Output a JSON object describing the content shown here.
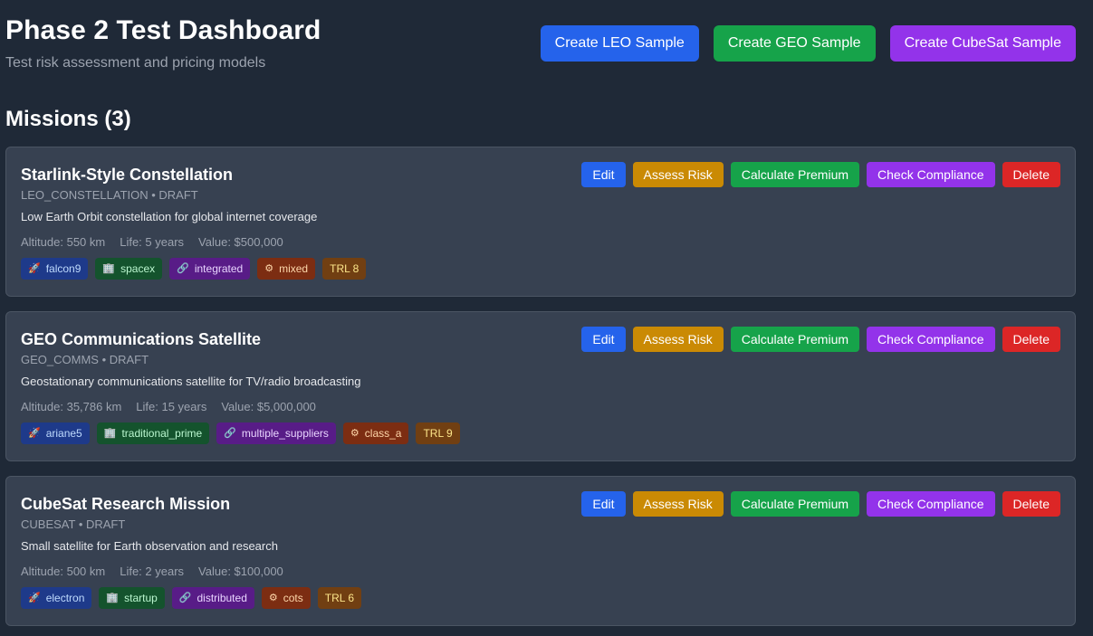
{
  "header": {
    "title": "Phase 2 Test Dashboard",
    "subtitle": "Test risk assessment and pricing models"
  },
  "sample_buttons": [
    {
      "label": "Create LEO Sample",
      "color": "#2563eb"
    },
    {
      "label": "Create GEO Sample",
      "color": "#16a34a"
    },
    {
      "label": "Create CubeSat Sample",
      "color": "#9333ea"
    }
  ],
  "missions_heading": "Missions (3)",
  "card_actions": {
    "edit": "Edit",
    "assess_risk": "Assess Risk",
    "calculate_premium": "Calculate Premium",
    "check_compliance": "Check Compliance",
    "delete": "Delete"
  },
  "colors": {
    "background": "#1f2937",
    "card": "#374151",
    "edit": "#2563eb",
    "assess_risk": "#ca8a04",
    "calculate_premium": "#16a34a",
    "check_compliance": "#9333ea",
    "delete": "#dc2626"
  },
  "missions": [
    {
      "name": "Starlink-Style Constellation",
      "meta": "LEO_CONSTELLATION • DRAFT",
      "description": "Low Earth Orbit constellation for global internet coverage",
      "altitude": "Altitude: 550 km",
      "life": "Life: 5 years",
      "value": "Value: $500,000",
      "tags": {
        "launch": "falcon9",
        "manufacturer": "spacex",
        "supply": "integrated",
        "parts": "mixed",
        "trl": "TRL 8"
      }
    },
    {
      "name": "GEO Communications Satellite",
      "meta": "GEO_COMMS • DRAFT",
      "description": "Geostationary communications satellite for TV/radio broadcasting",
      "altitude": "Altitude: 35,786 km",
      "life": "Life: 15 years",
      "value": "Value: $5,000,000",
      "tags": {
        "launch": "ariane5",
        "manufacturer": "traditional_prime",
        "supply": "multiple_suppliers",
        "parts": "class_a",
        "trl": "TRL 9"
      }
    },
    {
      "name": "CubeSat Research Mission",
      "meta": "CUBESAT • DRAFT",
      "description": "Small satellite for Earth observation and research",
      "altitude": "Altitude: 500 km",
      "life": "Life: 2 years",
      "value": "Value: $100,000",
      "tags": {
        "launch": "electron",
        "manufacturer": "startup",
        "supply": "distributed",
        "parts": "cots",
        "trl": "TRL 6"
      }
    }
  ],
  "icons": {
    "launch": "rocket-icon",
    "manufacturer": "building-icon",
    "supply": "link-icon",
    "parts": "gear-icon"
  }
}
